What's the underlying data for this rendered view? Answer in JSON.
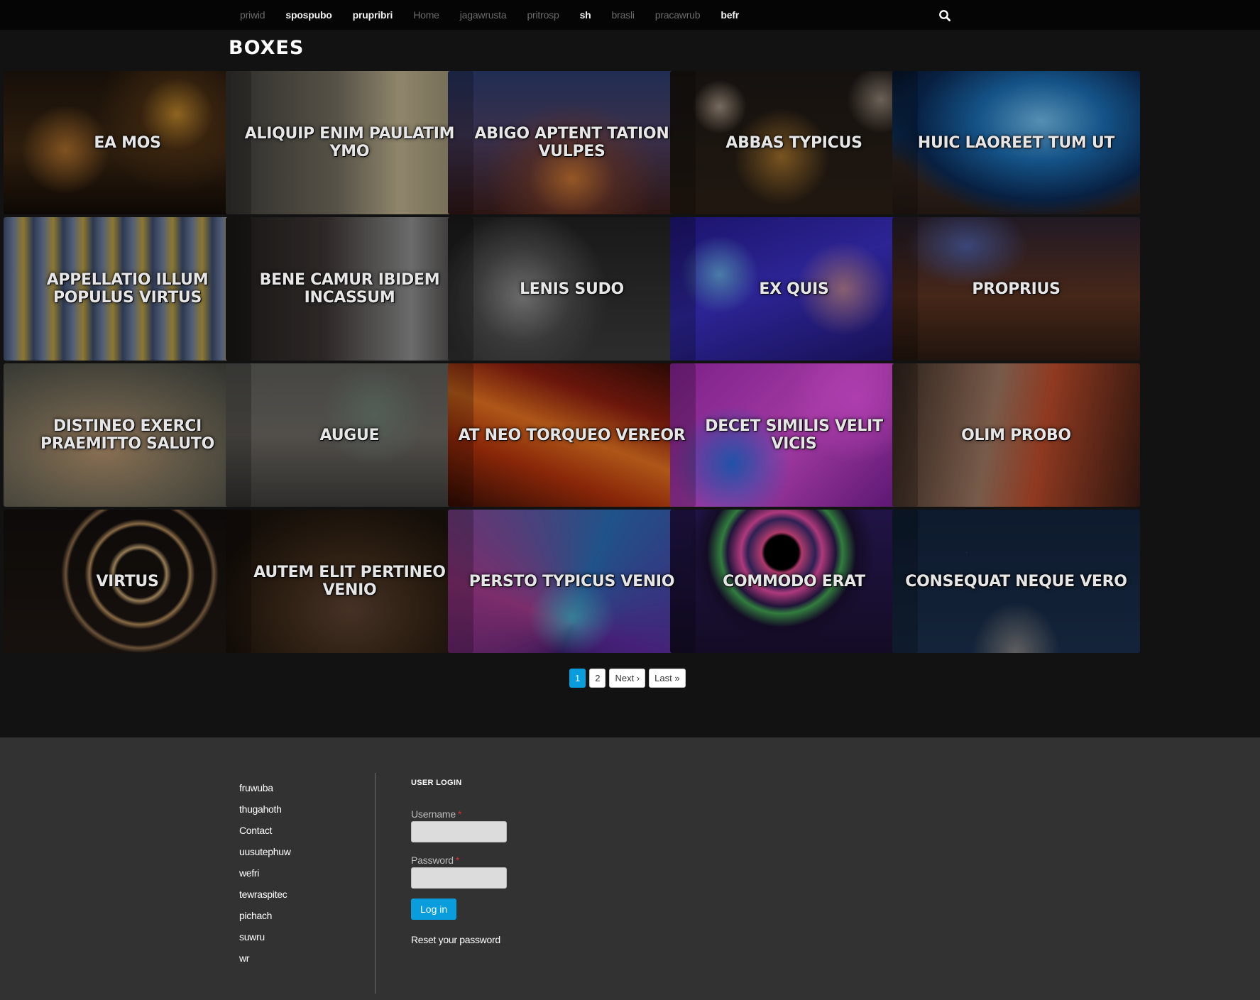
{
  "nav": {
    "items": [
      {
        "label": "priwid",
        "style": "dim"
      },
      {
        "label": "spospubo",
        "style": "bright"
      },
      {
        "label": "prupribri",
        "style": "bright"
      },
      {
        "label": "Home",
        "style": "dim"
      },
      {
        "label": "jagawrusta",
        "style": "dim"
      },
      {
        "label": "pritrosp",
        "style": "dim"
      },
      {
        "label": "sh",
        "style": "bright"
      },
      {
        "label": "brasli",
        "style": "dim"
      },
      {
        "label": "pracawrub",
        "style": "dim"
      },
      {
        "label": "befr",
        "style": "bright"
      }
    ],
    "search_icon": "search-icon"
  },
  "page": {
    "title": "BOXES"
  },
  "tiles": [
    {
      "title": "EA MOS",
      "bg": "radial-gradient(circle at 70% 30%, #b6812a 0%, rgba(80,50,20,0.7) 18%, transparent 40%), radial-gradient(circle at 25% 55%, #a56a2a 0%, transparent 22%), linear-gradient(180deg, #1d140c 0%, #3a2612 55%, #120b06 100%)"
    },
    {
      "title": "ALIQUIP ENIM PAULATIM YMO",
      "bg": "linear-gradient(90deg, #3c3a37 0%, #6f6a5c 45%, #b8ab8a 70%, #8a8166 100%)"
    },
    {
      "title": "ABIGO APTENT TATION VULPES",
      "bg": "radial-gradient(ellipse at 50% 75%, #c07030 0%, rgba(120,60,40,0.6) 25%, transparent 50%), linear-gradient(180deg, #2a3a6a 0%, #4b3f63 45%, #3a1c1a 100%)"
    },
    {
      "title": "ABBAS TYPICUS",
      "bg": "radial-gradient(circle at 20% 25%, #9a8a7a 0%, transparent 12%), radial-gradient(circle at 85% 20%, #8a7d70 0%, transparent 14%), radial-gradient(circle at 45% 60%, #9b6c2a 0%, transparent 30%), linear-gradient(180deg, #1c1714 0%, #2a1f15 100%)"
    },
    {
      "title": "HUIC LAOREET TUM UT",
      "bg": "radial-gradient(ellipse at 60% 35%, #6fb8e6 0%, #1b6bae 30%, #0b2a55 60%, transparent 75%), linear-gradient(180deg, #0a1a36 0%, #123a6a 45%, #3b2a22 65%, #2a1d17 100%)"
    },
    {
      "title": "APPELLATIO ILLUM POPULUS VIRTUS",
      "bg": "repeating-linear-gradient(90deg, #3a4a6a 0px, #6a7a98 14px, #b59a3e 28px, #3a4a6a 42px)"
    },
    {
      "title": "BENE CAMUR IBIDEM INCASSUM",
      "bg": "linear-gradient(90deg, #1e1b1a 0%, #3a3432 40%, #8a8a8a 75%, #2e2b2a 100%)"
    },
    {
      "title": "LENIS SUDO",
      "bg": "radial-gradient(circle at 30% 55%, #8a8a8a 0%, #4a4a4a 25%, transparent 45%), linear-gradient(180deg, #202020 0%, #3a3a3a 100%)"
    },
    {
      "title": "EX QUIS",
      "bg": "radial-gradient(circle at 20% 40%, #5fa0d8 0%, transparent 18%), radial-gradient(circle at 70% 50%, #b07a90 0%, transparent 25%), linear-gradient(160deg, #241a8a 0%, #3a2fbf 45%, #1c1466 100%)"
    },
    {
      "title": "PROPRIUS",
      "bg": "radial-gradient(ellipse at 30% 20%, #4c5a9a 0%, transparent 25%), linear-gradient(180deg, #2b2130 0%, #5a3220 55%, #2a1a12 100%)"
    },
    {
      "title": "DISTINEO EXERCI PRAEMITTO SALUTO",
      "bg": "radial-gradient(ellipse at 40% 60%, #b08f6a 0%, #7a6f5a 40%, #4c4d45 80%, #3a3832 100%)"
    },
    {
      "title": "AUGUE",
      "bg": "radial-gradient(circle at 60% 35%, #6a7a70 0%, transparent 30%), linear-gradient(180deg, #5a5a56 0%, #6a6660 50%, #3c3a38 100%)"
    },
    {
      "title": "AT NEO TORQUEO VEREOR",
      "bg": "linear-gradient(20deg, #3a0f05 0%, #b0320c 30%, #e07020 50%, #8a1e10 70%, #2a0a05 100%)"
    },
    {
      "title": "DECET SIMILIS VELIT VICIS",
      "bg": "radial-gradient(circle at 25% 70%, #2a6ad8 0%, transparent 28%), radial-gradient(circle at 75% 25%, #e050e0 0%, transparent 30%), linear-gradient(135deg, #a02ab0 0%, #d04ad0 50%, #6a1a8a 100%)"
    },
    {
      "title": "OLIM PROBO",
      "bg": "linear-gradient(100deg, #3a2a22 0%, #9a7560 40%, #b84a2a 60%, #3a1c14 100%)"
    },
    {
      "title": "VIRTUS",
      "bg": "radial-gradient(circle at 55% 45%, transparent 0%, transparent 15%, #c0a070 17%, transparent 20%, transparent 30%, #b08a5a 32%, transparent 35%, transparent 45%, #8a6a4a 47%, transparent 50%), linear-gradient(180deg, #120e0c 0%, #1e1712 100%)"
    },
    {
      "title": "AUTEM ELIT PERTINEO VENIO",
      "bg": "radial-gradient(ellipse at 50% 70%, #5a4030 0%, #3a2818 40%, #1a120c 80%), linear-gradient(180deg, #0e0c0a 0%, #3a2a1a 100%)"
    },
    {
      "title": "PERSTO TYPICUS VENIO",
      "bg": "radial-gradient(ellipse at 50% 75%, #4aa0c0 0%, transparent 25%), conic-gradient(from 200deg at 50% 80%, #3a1a6a, #a03a8a, #2a6ab0, #5a2a9a, #3a1a6a), linear-gradient(180deg, #0e0a18 0%, #1e1230 100%)"
    },
    {
      "title": "COMMODO ERAT",
      "bg": "radial-gradient(circle at 45% 30%, #000 0%, #000 10%, #e04a8a 12%, #3a2a6a 20%, #e04aa0 24%, #2a1a4a 32%, #40a050 36%, #1a1030 44%, transparent 55%), linear-gradient(180deg, #2a1a5a 0%, #1a1030 100%)"
    },
    {
      "title": "CONSEQUAT NEQUE VERO",
      "bg": "radial-gradient(circle at 30% 30%, #3a5a8a 0px, transparent 1px), radial-gradient(ellipse at 50% 100%, #7a7a7a 0%, transparent 25%), linear-gradient(180deg, #12223a 0%, #1a2e4a 100%)"
    }
  ],
  "pager": {
    "current": "1",
    "page2": "2",
    "next": "Next ›",
    "last": "Last »"
  },
  "footer": {
    "links": [
      "fruwuba",
      "thugahoth",
      "Contact",
      "uusutephuw",
      "wefri",
      "tewraspitec",
      "pichach",
      "suwru",
      "wr"
    ],
    "login": {
      "title": "USER LOGIN",
      "username_label": "Username",
      "password_label": "Password",
      "required_mark": "*",
      "button": "Log in",
      "reset": "Reset your password"
    }
  }
}
